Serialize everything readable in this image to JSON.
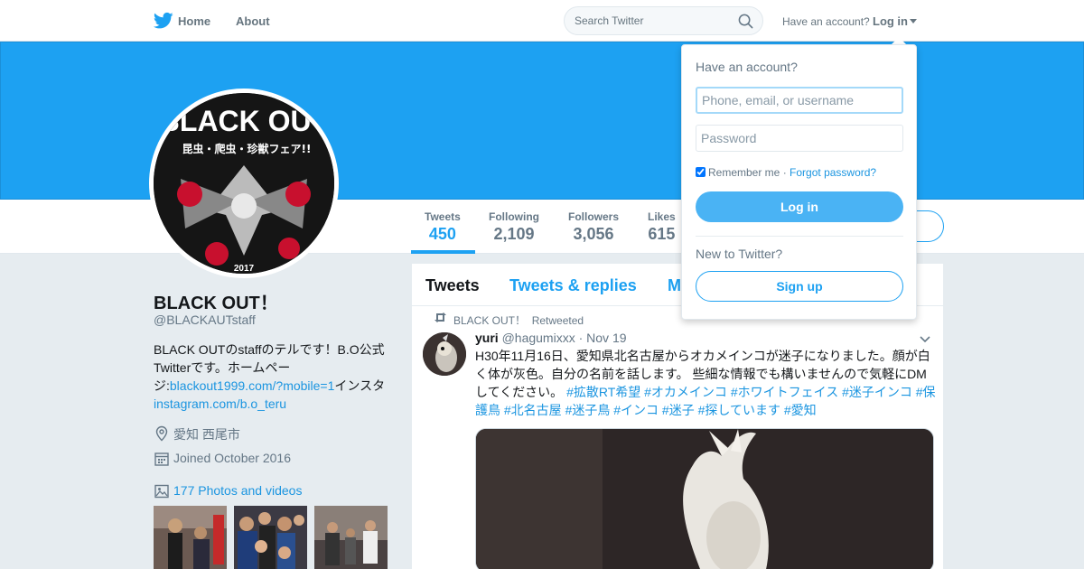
{
  "nav": {
    "home": "Home",
    "about": "About",
    "search_placeholder": "Search Twitter",
    "have_account": "Have an account?",
    "login": "Log in",
    "icons": {
      "logo": "twitter-bird-icon",
      "search": "search-icon",
      "caret": "caret-down-icon"
    }
  },
  "colors": {
    "brand": "#1da1f2",
    "link": "#1b95e0",
    "banner": "#1da1f2",
    "page_bg": "#e6ecf0"
  },
  "profile": {
    "name": "BLACK OUT！",
    "handle": "@BLACKAUTstaff",
    "bio_pre": "BLACK OUTのstaffのテルです！B.O公式Twitterです。ホームページ:",
    "bio_link1": "blackout1999.com/?mobile=1",
    "bio_mid": "インスタ",
    "bio_link2": "instagram.com/b.o_teru",
    "location": "愛知 西尾市",
    "joined": "Joined October 2016",
    "photos": "177 Photos and videos",
    "avatar_text": "BLACK OUT",
    "avatar_sub": "昆虫・爬虫・珍獣フェア!!",
    "avatar_year": "2017"
  },
  "stats": [
    {
      "label": "Tweets",
      "value": "450"
    },
    {
      "label": "Following",
      "value": "2,109"
    },
    {
      "label": "Followers",
      "value": "3,056"
    },
    {
      "label": "Likes",
      "value": "615"
    }
  ],
  "timeline": {
    "tabs": [
      "Tweets",
      "Tweets & replies",
      "M"
    ],
    "retweet_by": "BLACK OUT！",
    "retweeted": "Retweeted",
    "tweet": {
      "name": "yuri",
      "handle": "@hagumixxx",
      "time": "· Nov 19",
      "text": "H30年11月16日、愛知県北名古屋からオカメインコが迷子になりました。顔が白く体が灰色。自分の名前を話します。 些細な情報でも構いませんので気軽にDMしてください。",
      "hashtags": "#拡散RT希望 #オカメインコ #ホワイトフェイス #迷子インコ #保護鳥 #北名古屋 #迷子鳥 #インコ #迷子 #探しています #愛知"
    }
  },
  "login_dropdown": {
    "title": "Have an account?",
    "username_placeholder": "Phone, email, or username",
    "password_placeholder": "Password",
    "remember": "Remember me",
    "separator": "·",
    "forgot": "Forgot password?",
    "login_button": "Log in",
    "new_to": "New to Twitter?",
    "signup_button": "Sign up",
    "remember_checked": true
  }
}
